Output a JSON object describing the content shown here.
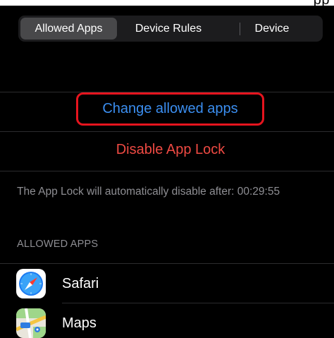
{
  "top_partial_text": "pp",
  "tabs": [
    {
      "label": "Allowed Apps",
      "selected": true
    },
    {
      "label": "Device Rules",
      "selected": false
    },
    {
      "label": "Device",
      "selected": false
    }
  ],
  "actions": {
    "change_allowed_apps": "Change allowed apps",
    "disable_app_lock": "Disable App Lock"
  },
  "notice": "The App Lock will automatically disable after: 00:29:55",
  "allowed_apps": {
    "header": "ALLOWED APPS",
    "items": [
      {
        "name": "Safari",
        "icon": "safari-icon"
      },
      {
        "name": "Maps",
        "icon": "maps-icon"
      }
    ]
  },
  "colors": {
    "accent_blue": "#3b8ef0",
    "destructive_red": "#ef4a43",
    "highlight_box": "#e6141e",
    "secondary_text": "#8e8e93"
  }
}
